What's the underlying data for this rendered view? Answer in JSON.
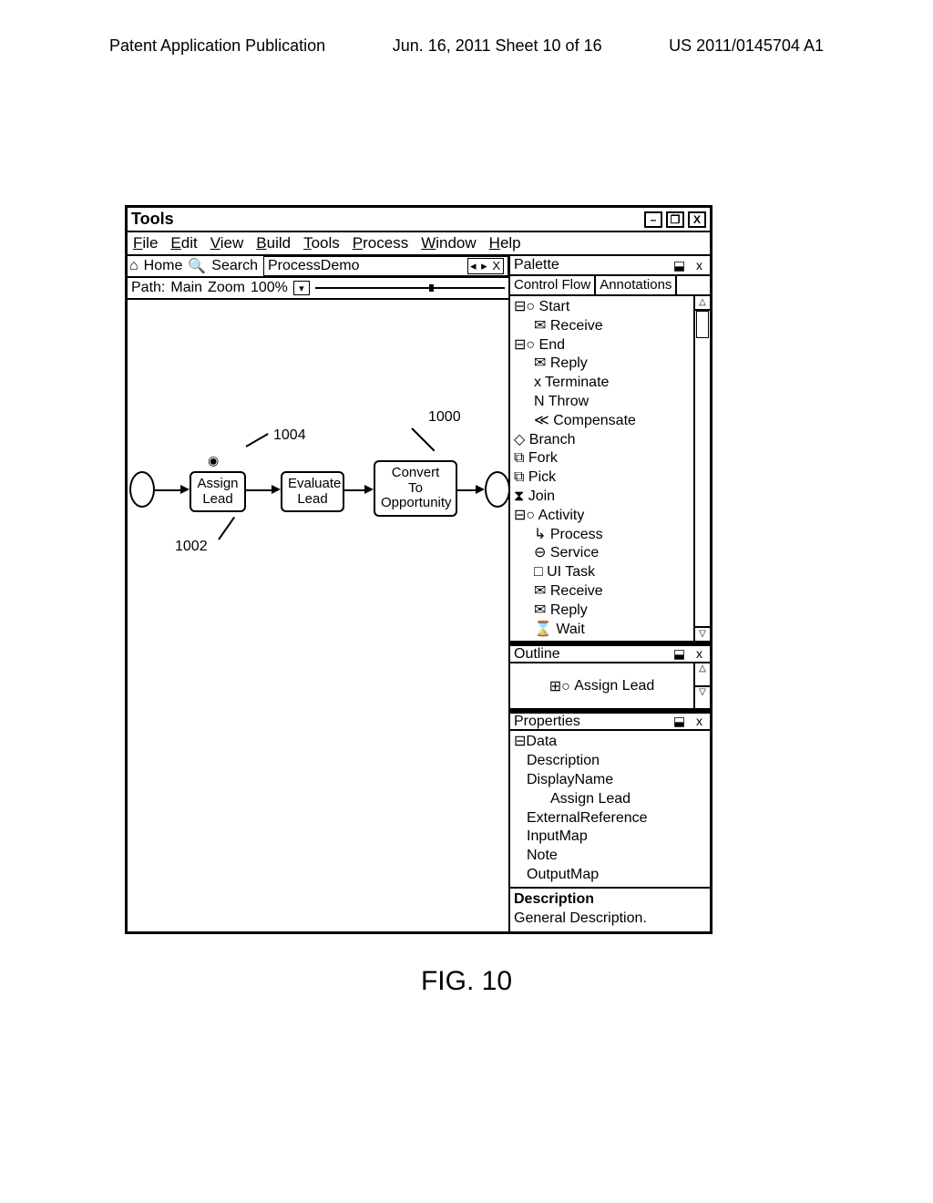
{
  "page_header": {
    "left": "Patent Application Publication",
    "center": "Jun. 16, 2011  Sheet 10 of 16",
    "right": "US 2011/0145704 A1"
  },
  "titlebar": {
    "title": "Tools"
  },
  "menubar": [
    "File",
    "Edit",
    "View",
    "Build",
    "Tools",
    "Process",
    "Window",
    "Help"
  ],
  "tabbar": {
    "home": "Home",
    "search": "Search",
    "doc": "ProcessDemo"
  },
  "pathbar": {
    "path_label": "Path:",
    "path_value": "Main",
    "zoom_label": "Zoom",
    "zoom_value": "100%"
  },
  "flow": {
    "n1": "Assign\nLead",
    "n2": "Evaluate\nLead",
    "n3": "Convert\nTo\nOpportunity"
  },
  "annotations": {
    "a1000": "1000",
    "a1002": "1002",
    "a1004": "1004"
  },
  "palette": {
    "title": "Palette",
    "tabs": {
      "flow": "Control Flow",
      "annot": "Annotations"
    },
    "items": [
      {
        "icon": "⊟○",
        "label": "Start"
      },
      {
        "icon": "✉",
        "label": "Receive",
        "indent": true
      },
      {
        "icon": "⊟○",
        "label": "End"
      },
      {
        "icon": "✉",
        "label": "Reply",
        "indent": true
      },
      {
        "icon": "x",
        "label": "Terminate",
        "indent": true
      },
      {
        "icon": "N",
        "label": "Throw",
        "indent": true
      },
      {
        "icon": "≪",
        "label": "Compensate",
        "indent": true
      },
      {
        "icon": "◇",
        "label": "Branch",
        "indent": false
      },
      {
        "icon": "⧉",
        "label": "Fork",
        "indent": false
      },
      {
        "icon": "⧉",
        "label": "Pick",
        "indent": false
      },
      {
        "icon": "⧗",
        "label": "Join",
        "indent": false
      },
      {
        "icon": "⊟○",
        "label": "Activity"
      },
      {
        "icon": "↳",
        "label": "Process",
        "indent": true
      },
      {
        "icon": "⊖",
        "label": "Service",
        "indent": true
      },
      {
        "icon": "□",
        "label": "UI Task",
        "indent": true
      },
      {
        "icon": "✉",
        "label": "Receive",
        "indent": true
      },
      {
        "icon": "✉",
        "label": "Reply",
        "indent": true
      },
      {
        "icon": "⌛",
        "label": "Wait",
        "indent": true
      }
    ]
  },
  "outline": {
    "title": "Outline",
    "item": "Assign Lead",
    "item_icon": "⊞○"
  },
  "properties": {
    "title": "Properties",
    "group": "Data",
    "group_icon": "⊟",
    "rows": [
      "Description",
      "DisplayName"
    ],
    "displayname_value": "Assign Lead",
    "rows2": [
      "ExternalReference",
      "InputMap",
      "Note",
      "OutputMap"
    ],
    "desc_header": "Description",
    "desc_value": "General Description."
  },
  "figure": "FIG. 10"
}
